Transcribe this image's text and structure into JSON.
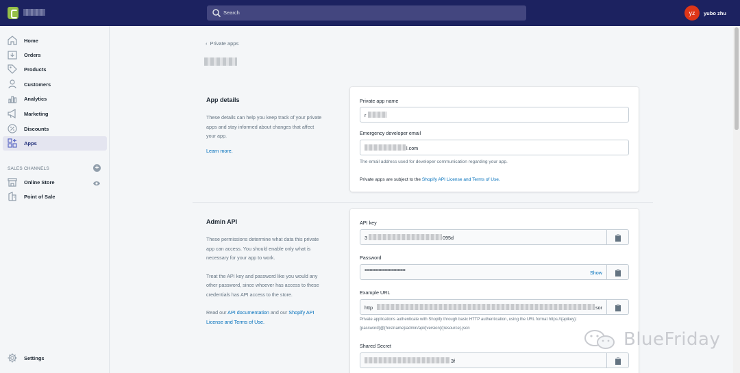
{
  "topbar": {
    "search_placeholder": "Search",
    "avatar_initials": "yz",
    "username": "yubo zhu"
  },
  "sidebar": {
    "items": [
      {
        "label": "Home",
        "icon": "home-icon"
      },
      {
        "label": "Orders",
        "icon": "orders-icon"
      },
      {
        "label": "Products",
        "icon": "tag-icon"
      },
      {
        "label": "Customers",
        "icon": "person-icon"
      },
      {
        "label": "Analytics",
        "icon": "bar-chart-icon"
      },
      {
        "label": "Marketing",
        "icon": "megaphone-icon"
      },
      {
        "label": "Discounts",
        "icon": "discount-icon"
      },
      {
        "label": "Apps",
        "icon": "apps-icon",
        "active": true
      }
    ],
    "sales_channels_title": "SALES CHANNELS",
    "channels": [
      {
        "label": "Online Store",
        "icon": "store-icon"
      },
      {
        "label": "Point of Sale",
        "icon": "pos-icon"
      }
    ],
    "settings_label": "Settings"
  },
  "main": {
    "back_label": "Private apps",
    "app_details": {
      "title": "App details",
      "description": "These details can help you keep track of your private apps and stay informed about changes that affect your app.",
      "learn_more": "Learn more.",
      "name_label": "Private app name",
      "name_value": "r",
      "email_label": "Emergency developer email",
      "email_value": "l.com",
      "email_help": "The email address used for developer communication regarding your app.",
      "terms_prefix": "Private apps are subject to the ",
      "terms_link": "Shopify API License and Terms of Use."
    },
    "admin_api": {
      "title": "Admin API",
      "desc1": "These permissions determine what data this private app can access. You should enable only what is necessary for your app to work.",
      "desc2": "Treat the API key and password like you would any other password, since whoever has access to these credentials has API access to the store.",
      "desc3_prefix": "Read our ",
      "desc3_link1": "API documentation",
      "desc3_mid": " and our ",
      "desc3_link2": "Shopify API License and Terms of Use.",
      "api_key_label": "API key",
      "api_key_start": "3",
      "api_key_end": "095d",
      "password_label": "Password",
      "password_value": "••••••••••••••••••••••••••••••••",
      "show_label": "Show",
      "example_url_label": "Example URL",
      "example_url_start": "http",
      "example_url_end": "sor",
      "example_url_help": "Private applications authenticate with Shopify through basic HTTP authentication, using the URL format https://{apikey}:{password}@{hostname}/admin/api/{version}/{resource}.json",
      "shared_secret_label": "Shared Secret",
      "shared_secret_end": "3f"
    }
  },
  "watermark": "BlueFriday"
}
